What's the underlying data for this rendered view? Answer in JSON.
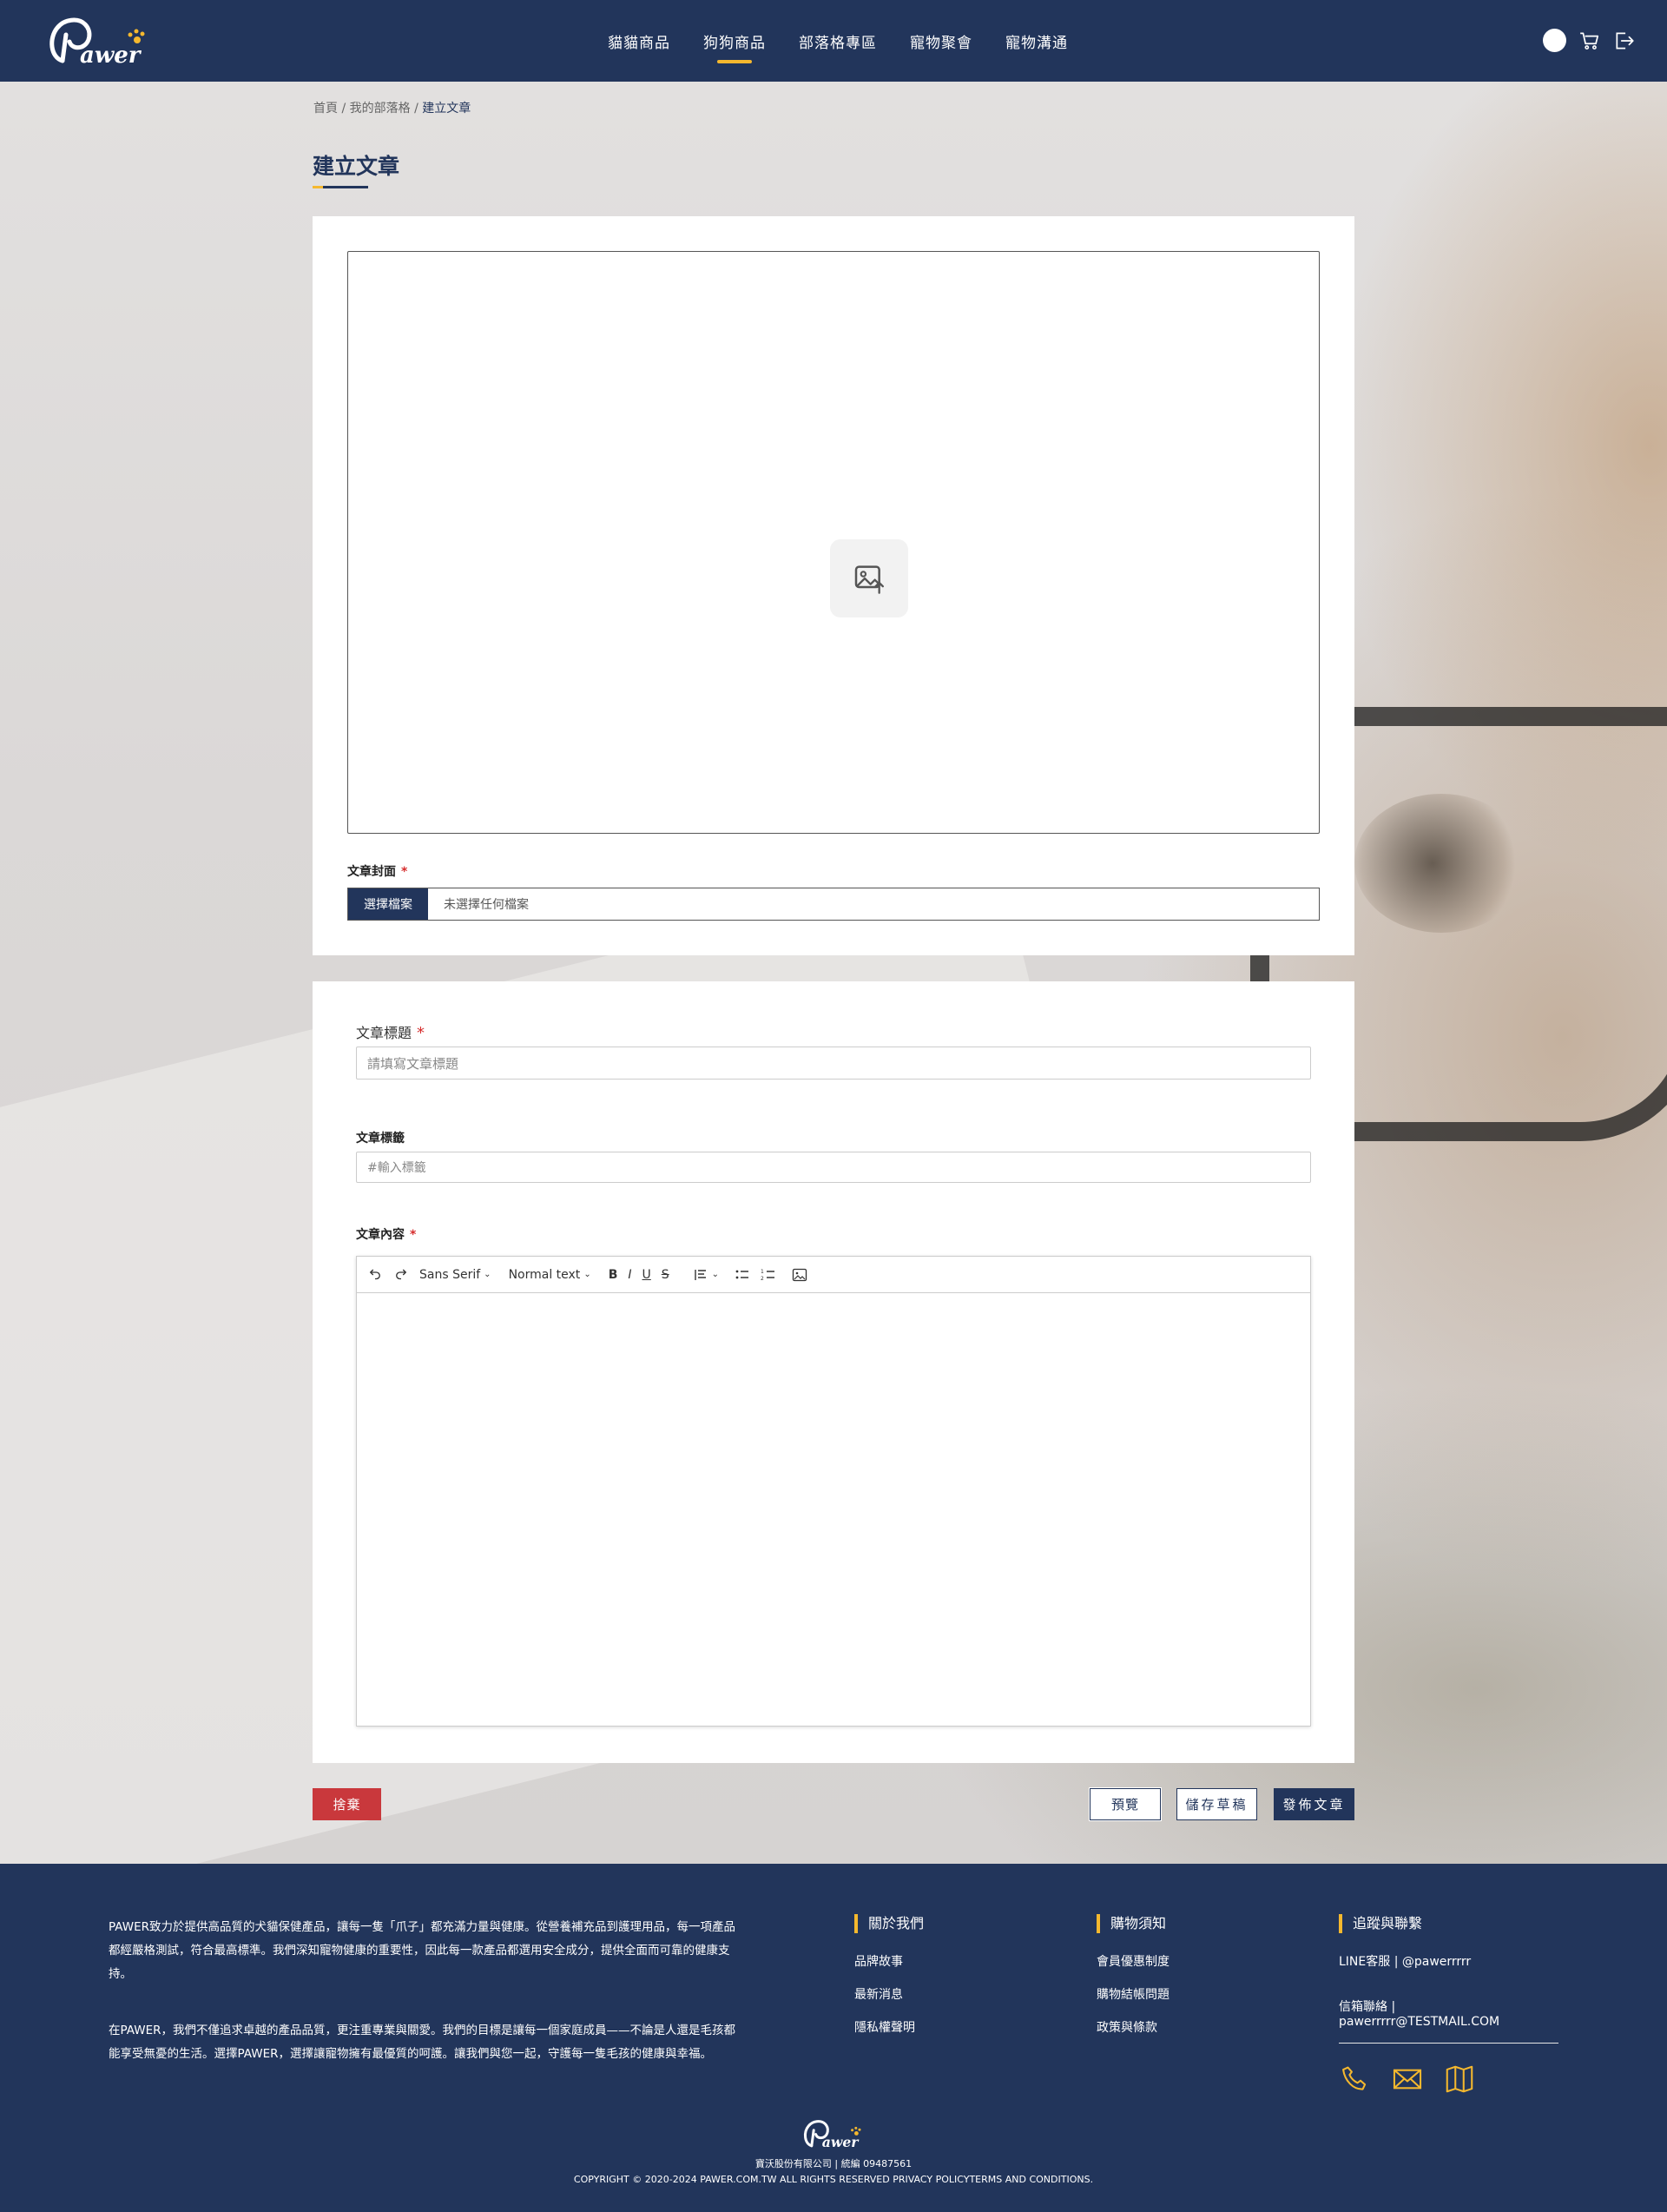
{
  "header": {
    "nav": [
      "貓貓商品",
      "狗狗商品",
      "部落格專區",
      "寵物聚會",
      "寵物溝通"
    ],
    "active_index": 1,
    "icons": [
      "user-avatar",
      "cart-icon",
      "logout-icon"
    ]
  },
  "breadcrumb": {
    "home": "首頁",
    "blog": "我的部落格",
    "current": "建立文章",
    "sep": "/"
  },
  "page_title": "建立文章",
  "cover": {
    "label": "文章封面",
    "required_mark": "*",
    "choose_file": "選擇檔案",
    "no_file": "未選擇任何檔案",
    "upload_icon": "image-upload-icon"
  },
  "form": {
    "title_label": "文章標題",
    "title_placeholder": "請填寫文章標題",
    "tags_label": "文章標籤",
    "tags_placeholder": "#輸入標籤",
    "content_label": "文章內容",
    "required_mark": "*"
  },
  "editor": {
    "font": "Sans Serif",
    "style": "Normal text",
    "tools": [
      "undo-icon",
      "redo-icon",
      "bold-icon",
      "italic-icon",
      "underline-icon",
      "strikethrough-icon",
      "align-icon",
      "bullet-list-icon",
      "numbered-list-icon",
      "image-icon"
    ]
  },
  "actions": {
    "discard": "捨棄",
    "preview": "預覽",
    "save_draft": "儲存草稿",
    "publish": "發佈文章"
  },
  "footer": {
    "about_1": "PAWER致力於提供高品質的犬貓保健產品，讓每一隻「爪子」都充滿力量與健康。從營養補充品到護理用品，每一項產品都經嚴格測試，符合最高標準。我們深知寵物健康的重要性，因此每一款產品都選用安全成分，提供全面而可靠的健康支持。",
    "about_2": "在PAWER，我們不僅追求卓越的產品品質，更注重專業與關愛。我們的目標是讓每一個家庭成員——不論是人還是毛孩都能享受無憂的生活。選擇PAWER，選擇讓寵物擁有最優質的呵護。讓我們與您一起，守護每一隻毛孩的健康與幸福。",
    "col1": {
      "title": "關於我們",
      "items": [
        "品牌故事",
        "最新消息",
        "隱私權聲明"
      ]
    },
    "col2": {
      "title": "購物須知",
      "items": [
        "會員優惠制度",
        "購物結帳問題",
        "政策與條款"
      ]
    },
    "contact": {
      "title": "追蹤與聯繫",
      "line": "LINE客服 | @pawerrrrr",
      "email": "信箱聯絡 | pawerrrrr@TESTMAIL.COM",
      "icons": [
        "phone-icon",
        "mail-icon",
        "map-icon"
      ]
    },
    "company": "寶沃股份有限公司 | 統編 09487561",
    "copyright": "COPYRIGHT © 2020-2024 PAWER.COM.TW ALL RIGHTS RESERVED PRIVACY POLICYTERMS AND CONDITIONS."
  },
  "colors": {
    "navy": "#22355b",
    "accent": "#f5b82e",
    "danger": "#c9383c"
  }
}
